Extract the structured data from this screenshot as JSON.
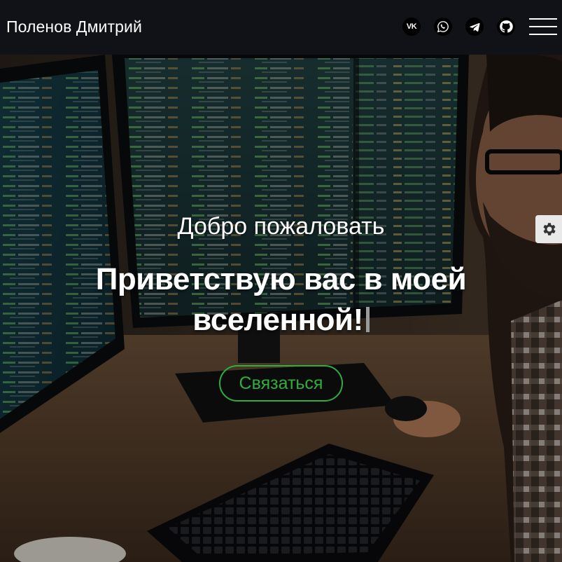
{
  "header": {
    "brand": "Поленов Дмитрий",
    "social": [
      {
        "name": "vk",
        "icon": "vk-icon",
        "glyph": "VK"
      },
      {
        "name": "whatsapp",
        "icon": "whatsapp-icon"
      },
      {
        "name": "telegram",
        "icon": "telegram-icon"
      },
      {
        "name": "github",
        "icon": "github-icon"
      }
    ],
    "menu_icon": "hamburger-menu-icon"
  },
  "hero": {
    "welcome": "Добро пожаловать",
    "headline_line1": "Приветствую вас в моей",
    "headline_line2": "вселенной!",
    "cta_label": "Связаться",
    "background": "developer-at-monitors-photo"
  },
  "settings": {
    "icon": "gear-icon"
  },
  "colors": {
    "navbar_bg": "#111217",
    "accent_green": "#2fae3f",
    "text": "#ffffff",
    "settings_tab": "#e9e9e9"
  }
}
